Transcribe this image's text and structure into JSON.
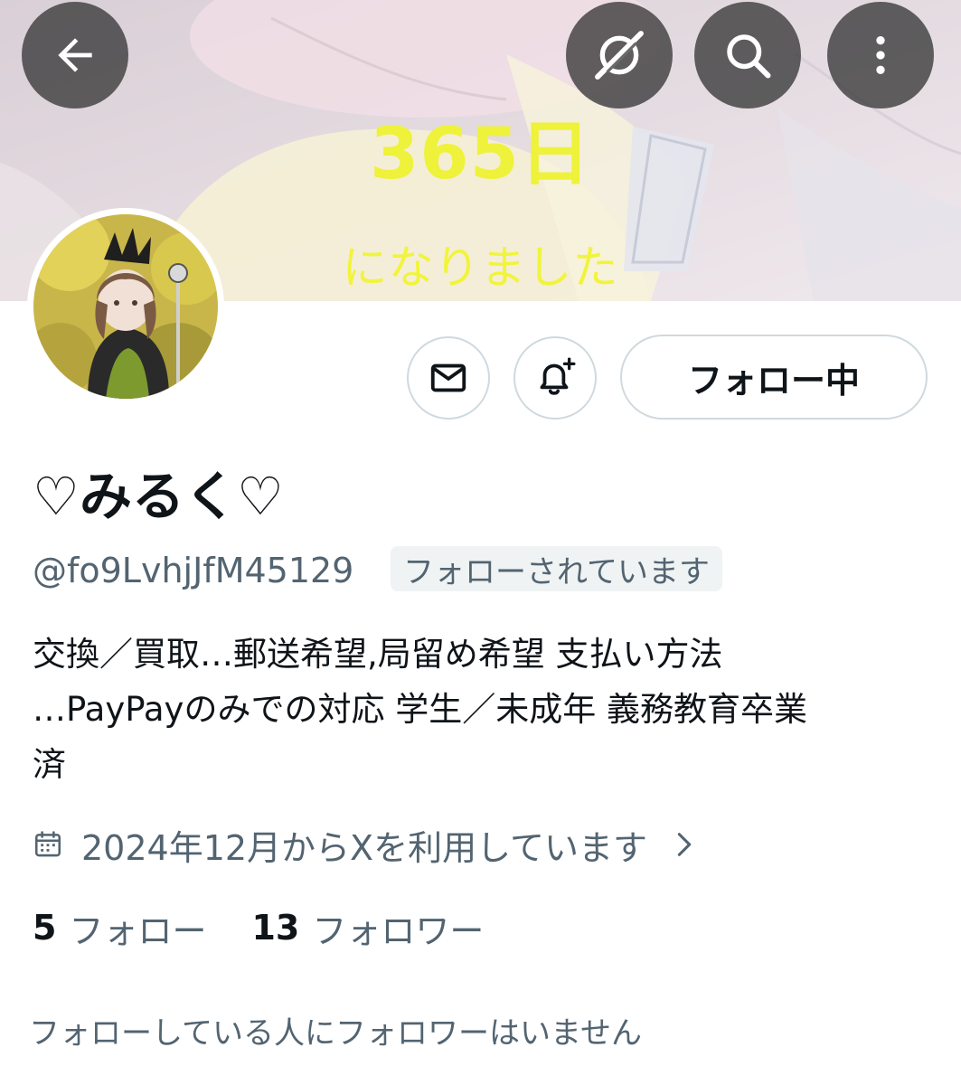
{
  "banner": {
    "line1": "365日",
    "line2": "になりました"
  },
  "top_nav": {
    "back_icon": "arrow-left-icon",
    "grok_icon": "grok-icon",
    "search_icon": "search-icon",
    "more_icon": "more-vertical-icon"
  },
  "actions": {
    "message_icon": "envelope-icon",
    "notify_icon": "bell-plus-icon",
    "follow_label": "フォロー中"
  },
  "profile": {
    "display_name": "♡みるく♡",
    "handle": "@fo9LvhjJfM45129",
    "follows_you": "フォローされています",
    "bio_lines": [
      "交換／買取…郵送希望,局留め希望  支払い方法",
      "…PayPayのみでの対応  学生／未成年   義務教育卒業",
      "済"
    ],
    "joined": "2024年12月からXを利用しています"
  },
  "stats": {
    "following_count": "5",
    "following_label": "フォロー",
    "followers_count": "13",
    "followers_label": "フォロワー"
  },
  "mutuals_note": "フォローしている人にフォロワーはいません",
  "colors": {
    "banner_text": "#eef23a",
    "secondary_text": "#536471",
    "primary_text": "#0f1419",
    "border": "#cfd9de"
  }
}
